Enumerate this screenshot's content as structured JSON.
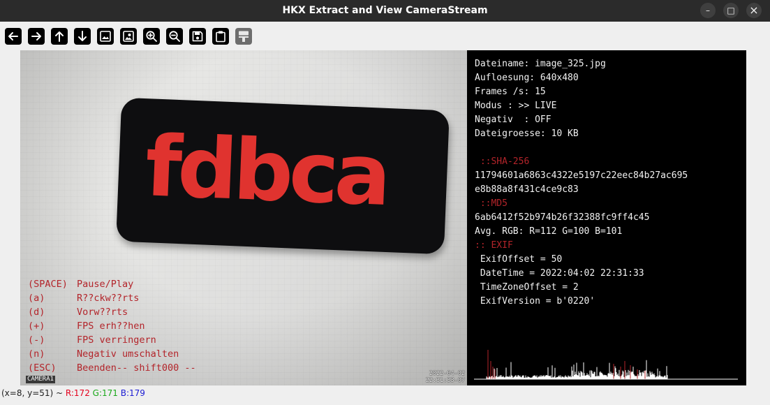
{
  "window": {
    "title": "HKX Extract and View CameraStream",
    "minimize": "–",
    "maximize": "□",
    "close": "×"
  },
  "toolbar": [
    {
      "name": "back-arrow-button",
      "icon": "arrow-left-icon"
    },
    {
      "name": "forward-arrow-button",
      "icon": "arrow-right-icon"
    },
    {
      "name": "up-arrow-button",
      "icon": "arrow-up-icon"
    },
    {
      "name": "down-arrow-button",
      "icon": "arrow-down-icon"
    },
    {
      "name": "image-button",
      "icon": "image-icon"
    },
    {
      "name": "image-person-button",
      "icon": "image-person-icon"
    },
    {
      "name": "zoom-in-button",
      "icon": "zoom-in-icon"
    },
    {
      "name": "zoom-out-button",
      "icon": "zoom-out-icon"
    },
    {
      "name": "save-button",
      "icon": "save-icon"
    },
    {
      "name": "clipboard-button",
      "icon": "clipboard-icon"
    },
    {
      "name": "paint-roller-button",
      "icon": "paint-roller-icon",
      "disabled": true
    }
  ],
  "image": {
    "brand_text": "fdbca",
    "camera_label": "CAMERA1",
    "timestamp_date": "2022-04-02",
    "timestamp_time": "22:31:33-07",
    "help": [
      {
        "key": "(SPACE)",
        "text": "Pause/Play"
      },
      {
        "key": "(a)",
        "text": "R??ckw??rts"
      },
      {
        "key": "(d)",
        "text": "Vorw??rts"
      },
      {
        "key": "(+)",
        "text": "FPS erh??hen"
      },
      {
        "key": "(-)",
        "text": "FPS verringern"
      },
      {
        "key": "(n)",
        "text": "Negativ umschalten"
      },
      {
        "key": "(ESC)",
        "text": "Beenden-- shift000 --"
      }
    ]
  },
  "info": {
    "dateiname": "Dateiname: image_325.jpg",
    "aufloesung": "Aufloesung: 640x480",
    "frames": "Frames /s: 15",
    "modus": "Modus : >> LIVE",
    "negativ": "Negativ  : OFF",
    "dateigroesse": "Dateigroesse: 10 KB",
    "sha_header": " ::SHA-256",
    "sha_line1": "11794601a6863c4322e5197c22eec84b27ac695",
    "sha_line2": "e8b88a8f431c4ce9c83",
    "md5_header": " ::MD5",
    "md5": "6ab6412f52b974b26f32388fc9ff4c45",
    "avg_rgb": "Avg. RGB: R=112 G=100 B=101",
    "exif_header": ":: EXIF",
    "exif_offset": " ExifOffset = 50",
    "datetime": " DateTime = 2022:04:02 22:31:33",
    "timezone": " TimeZoneOffset = 2",
    "exif_version": " ExifVersion = b'0220'"
  },
  "status": {
    "coords": "(x=8, y=51) ~ ",
    "r": "R:172",
    "g": "G:171",
    "b": "B:179"
  },
  "colors": {
    "titlebar": "#2b2b2b",
    "overlay_text": "#b3242a",
    "info_bg": "#000000",
    "brand_red": "#e0332f"
  }
}
